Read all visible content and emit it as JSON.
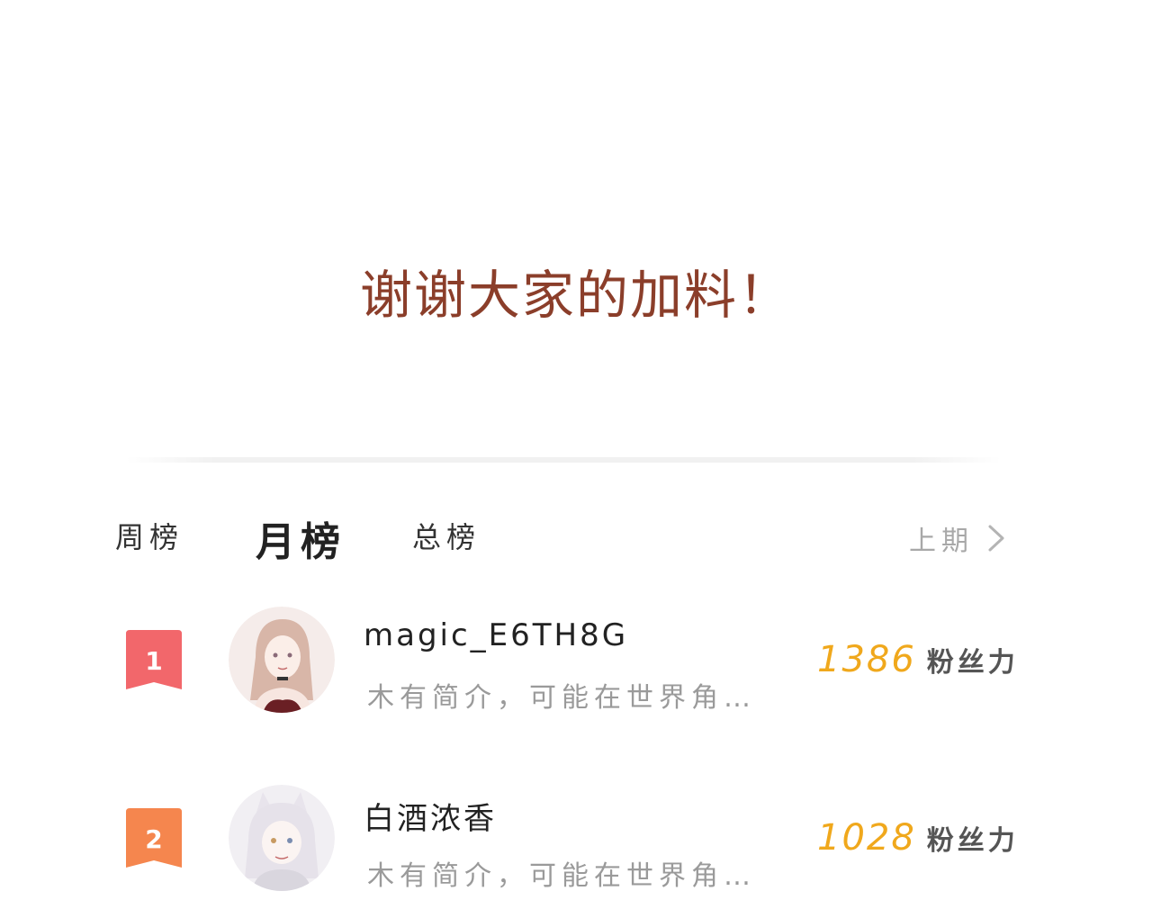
{
  "banner": {
    "thanks_text": "谢谢大家的加料！"
  },
  "tabs": [
    {
      "label": "周榜",
      "active": false
    },
    {
      "label": "月榜",
      "active": true
    },
    {
      "label": "总榜",
      "active": false
    }
  ],
  "previous": {
    "label": "上期",
    "icon": "chevron-right-icon"
  },
  "ranking": [
    {
      "rank": "1",
      "badge_color": "#f2676b",
      "name": "magic_E6TH8G",
      "bio": "木有简介，可能在世界角…",
      "fans_value": "1386",
      "fans_unit": "粉丝力"
    },
    {
      "rank": "2",
      "badge_color": "#f5864e",
      "name": "白酒浓香",
      "bio": "木有简介，可能在世界角…",
      "fans_value": "1028",
      "fans_unit": "粉丝力"
    }
  ],
  "colors": {
    "thanks_text": "#8b3e2a",
    "fans_value": "#f0a81c",
    "muted_text": "#9a9a9a"
  }
}
